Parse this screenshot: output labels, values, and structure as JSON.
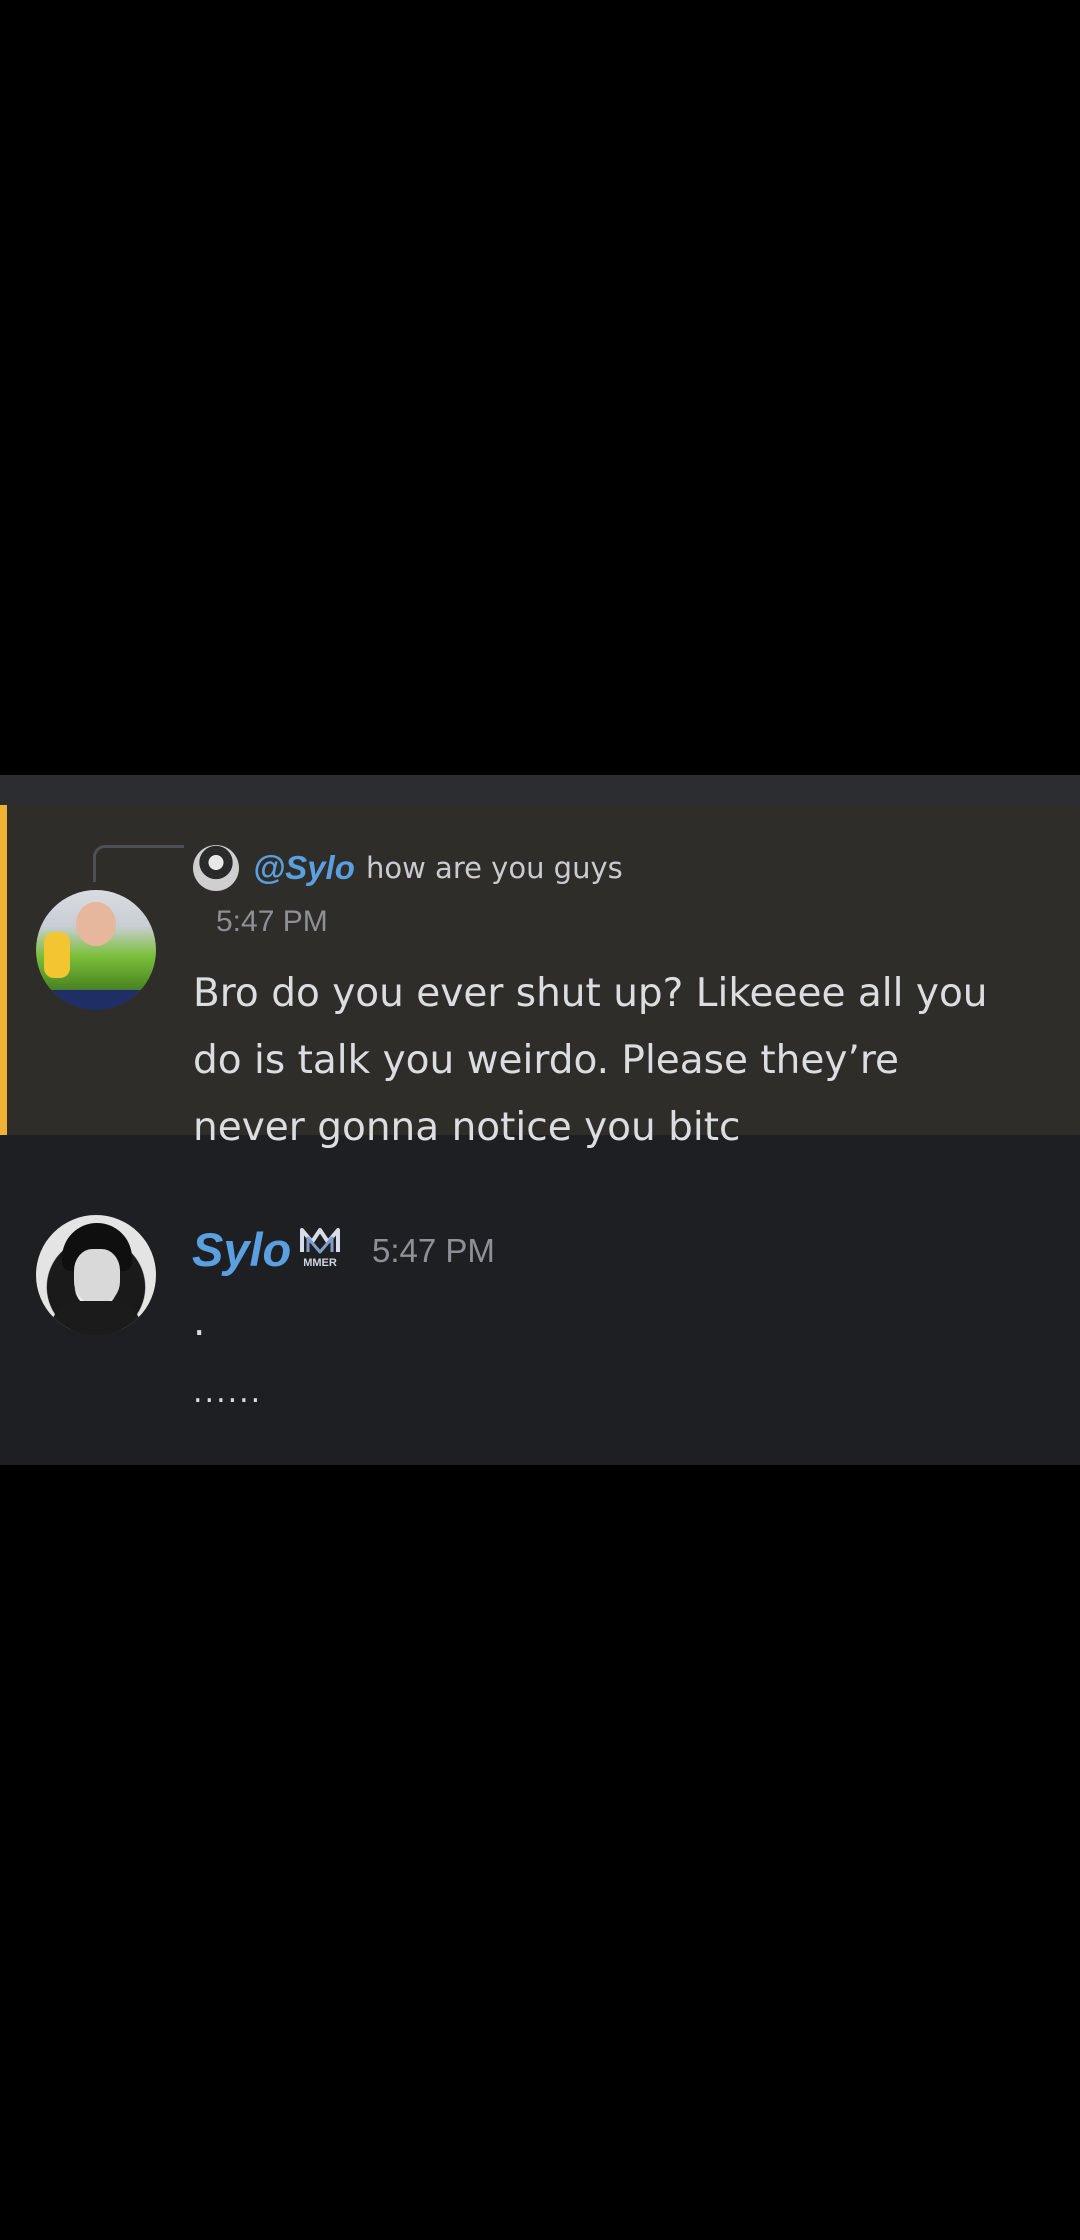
{
  "messages": {
    "highlighted": {
      "reply": {
        "mention": "@Sylo",
        "text": "how are you guys"
      },
      "timestamp": "5:47 PM",
      "lines": [
        "Bro do you ever shut up? Likeeee all you",
        "do is talk you weirdo. Please they’re",
        "never gonna notice you bitc"
      ]
    },
    "second": {
      "username": "Sylo",
      "badge_icon": "mmer-badge-icon",
      "timestamp": "5:47 PM",
      "line1": ".",
      "line2": "......"
    }
  },
  "typing_indicator": "typing-dots-icon",
  "colors": {
    "background": "#000000",
    "chat_bg": "#1e1f22",
    "highlight_bg": "#2f2d29",
    "highlight_bar": "#f0b232",
    "mention_blue": "#5a9fe0",
    "text": "#dcdde1",
    "muted": "#8e9097"
  }
}
